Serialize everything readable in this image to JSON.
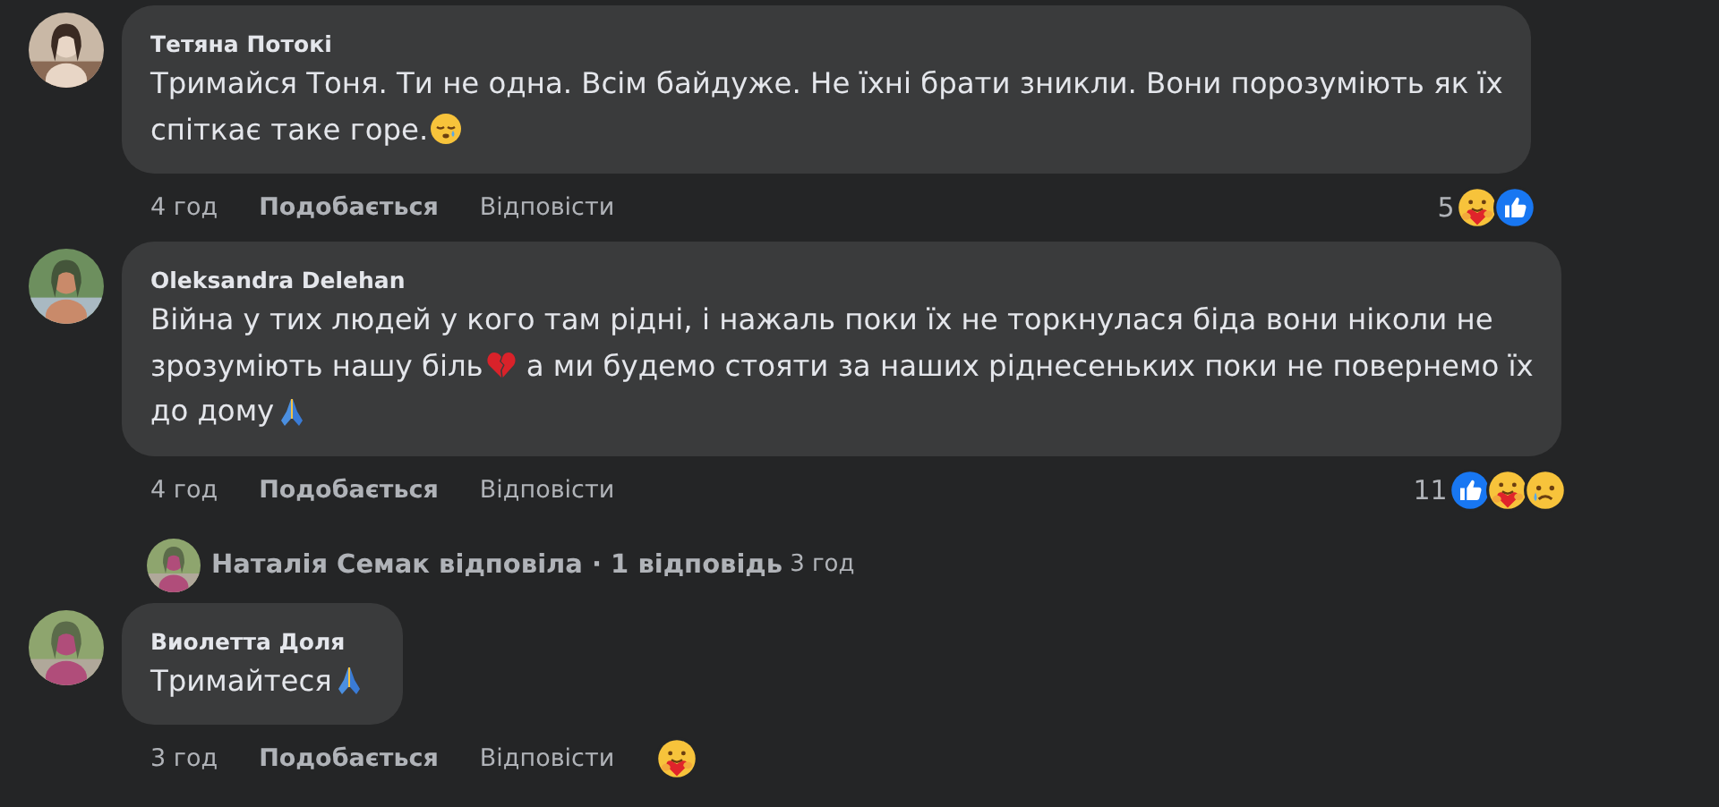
{
  "comments": [
    {
      "author": "Тетяна Потокі",
      "lines": [
        [
          {
            "kind": "text",
            "text": "Тримайся Тоня. Ти не одна. Всім байдуже. Не їхні брати зникли. Вони порозуміють як їх"
          }
        ],
        [
          {
            "kind": "text",
            "text": "спіткає таке горе."
          },
          {
            "kind": "sleepy"
          }
        ]
      ],
      "time": "4 год",
      "like": "Подобається",
      "reply": "Відповісти",
      "reaction_count": "5",
      "reactions": [
        {
          "kind": "care"
        },
        {
          "kind": "like"
        }
      ]
    },
    {
      "author": "Oleksandra Delehan",
      "lines": [
        [
          {
            "kind": "text",
            "text": "Війна у тих людей у кого там рідні, і нажаль поки їх не торкнулася біда вони ніколи не"
          }
        ],
        [
          {
            "kind": "text",
            "text": "зрозуміють нашу біль"
          },
          {
            "kind": "heartbreak"
          },
          {
            "kind": "text",
            "text": "а ми будемо стояти за наших ріднесеньких поки не повернемо їх"
          }
        ],
        [
          {
            "kind": "text",
            "text": "до дому"
          },
          {
            "kind": "pray"
          }
        ]
      ],
      "time": "4 год",
      "like": "Подобається",
      "reply": "Відповісти",
      "reaction_count": "11",
      "reactions": [
        {
          "kind": "like"
        },
        {
          "kind": "care"
        },
        {
          "kind": "sad"
        }
      ],
      "replies_summary": {
        "text": "Наталія Семак відповіла · 1 відповідь",
        "time": "3 год"
      }
    },
    {
      "author": "Виолетта Доля",
      "lines": [
        [
          {
            "kind": "text",
            "text": "Тримайтеся"
          },
          {
            "kind": "pray"
          }
        ]
      ],
      "time": "3 год",
      "like": "Подобається",
      "reply": "Відповісти",
      "reactions": [
        {
          "kind": "care"
        }
      ]
    }
  ]
}
